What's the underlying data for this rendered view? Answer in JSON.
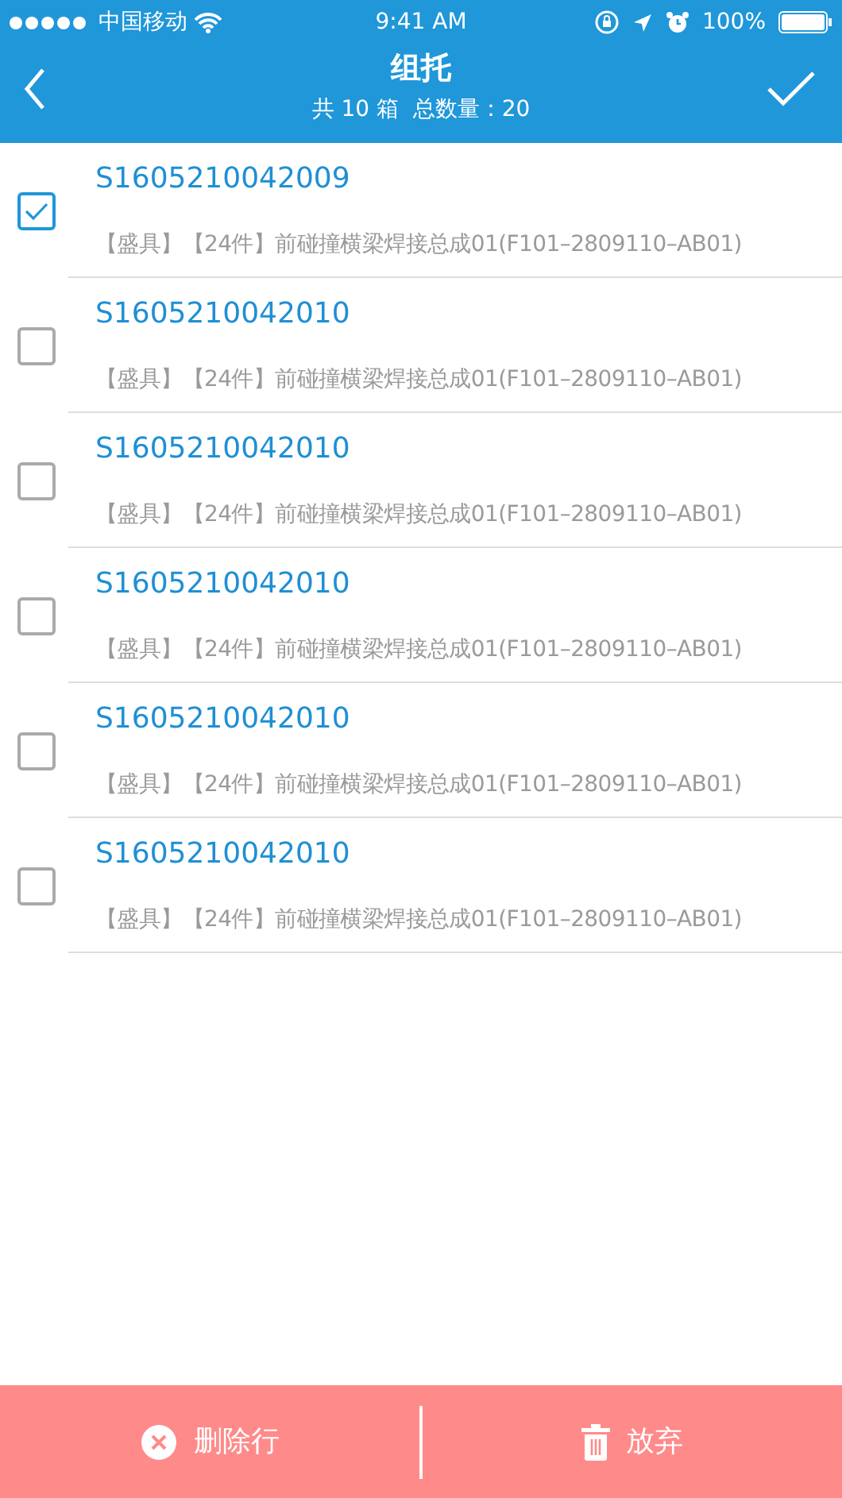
{
  "status_bar": {
    "carrier": "中国移动",
    "time": "9:41 AM",
    "battery": "100%"
  },
  "header": {
    "title": "组托",
    "subtitle": "共 10 箱  总数量：20"
  },
  "items": [
    {
      "code": "S1605210042009",
      "description": "【盛具】【24件】前碰撞横梁焊接总成01(F101–2809110–AB01)",
      "checked": true
    },
    {
      "code": "S1605210042010",
      "description": "【盛具】【24件】前碰撞横梁焊接总成01(F101–2809110–AB01)",
      "checked": false
    },
    {
      "code": "S1605210042010",
      "description": "【盛具】【24件】前碰撞横梁焊接总成01(F101–2809110–AB01)",
      "checked": false
    },
    {
      "code": "S1605210042010",
      "description": "【盛具】【24件】前碰撞横梁焊接总成01(F101–2809110–AB01)",
      "checked": false
    },
    {
      "code": "S1605210042010",
      "description": "【盛具】【24件】前碰撞横梁焊接总成01(F101–2809110–AB01)",
      "checked": false
    },
    {
      "code": "S1605210042010",
      "description": "【盛具】【24件】前碰撞横梁焊接总成01(F101–2809110–AB01)",
      "checked": false
    }
  ],
  "footer": {
    "buttons": [
      {
        "kind": "delete",
        "label": "删除行"
      },
      {
        "kind": "discard",
        "label": "放弃"
      }
    ]
  }
}
